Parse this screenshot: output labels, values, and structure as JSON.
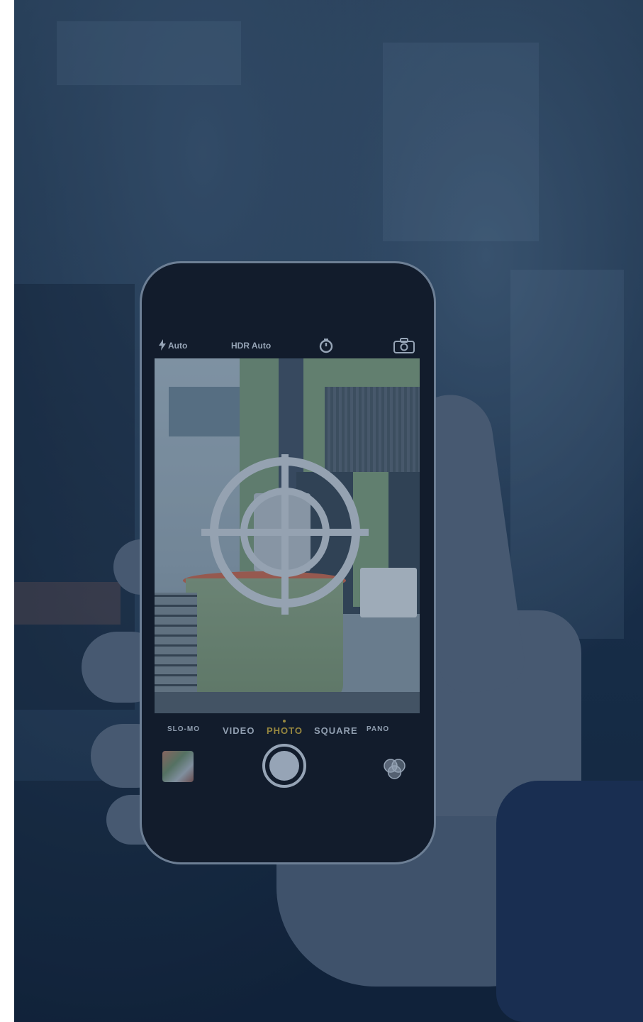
{
  "camera": {
    "flash_label": "Auto",
    "hdr_label": "HDR Auto",
    "modes": [
      {
        "label": "SLO-MO"
      },
      {
        "label": "VIDEO"
      },
      {
        "label": "PHOTO"
      },
      {
        "label": "SQUARE"
      },
      {
        "label": "PANO"
      }
    ],
    "active_mode": "PHOTO"
  },
  "colors": {
    "overlay": "#142d50",
    "active_mode": "#c9a93a",
    "ui_text": "#c8d2de"
  },
  "icons": [
    "flash-icon",
    "timer-icon",
    "camera-switch-icon",
    "filters-icon",
    "reticle-icon"
  ]
}
